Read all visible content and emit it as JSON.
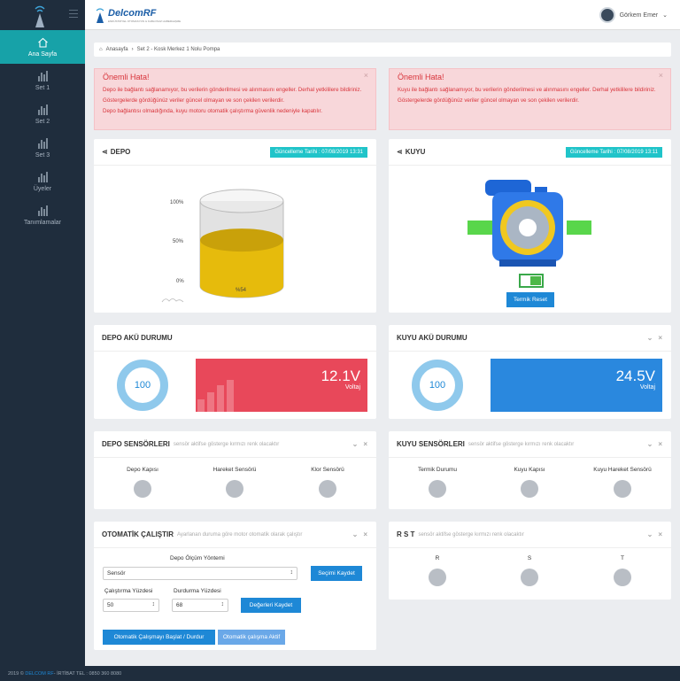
{
  "app": {
    "brand": "DelcomRF",
    "brand_sub": "ENDÜSTRİYEL OTOMASYON & KABLOSUZ HABERLEŞME",
    "user_name": "Görkem Emer"
  },
  "sidebar": {
    "items": [
      {
        "label": "Ana Sayfa",
        "icon": "home-icon",
        "active": true
      },
      {
        "label": "Set 1",
        "icon": "chart-icon"
      },
      {
        "label": "Set 2",
        "icon": "chart-icon"
      },
      {
        "label": "Set 3",
        "icon": "chart-icon"
      },
      {
        "label": "Üyeler",
        "icon": "chart-icon"
      },
      {
        "label": "Tanımlamalar",
        "icon": "chart-icon"
      }
    ]
  },
  "breadcrumb": {
    "home": "Anasayfa",
    "current": "Set 2 - Kosk Merkez 1 Nolu Pompa"
  },
  "alerts": {
    "left": {
      "title": "Önemli Hata!",
      "lines": [
        "Depo ile bağlantı sağlanamıyor, bu verilerin gönderilmesi ve alınmasını engeller. Derhal yetkililere bildiriniz.",
        "Göstergelerde gördüğünüz veriler güncel olmayan ve son çekilen verilerdir.",
        "Depo bağlantısı olmadığında, kuyu motoru otomatik çalıştırma güvenlik nedeniyle kapatılır."
      ]
    },
    "right": {
      "title": "Önemli Hata!",
      "lines": [
        "Kuyu ile bağlantı sağlanamıyor, bu verilerin gönderilmesi ve alınmasını engeller. Derhal yetkililere bildiriniz.",
        "Göstergelerde gördüğünüz veriler güncel olmayan ve son çekilen verilerdir."
      ]
    }
  },
  "depo": {
    "title": "DEPO",
    "date": "Güncelleme Tarihi : 07/08/2019 13:31",
    "scale": [
      "100%",
      "50%",
      "0%"
    ],
    "level_label": "%54",
    "level": 0.54
  },
  "kuyu": {
    "title": "KUYU",
    "date": "Güncelleme Tarihi : 07/08/2019 13:11",
    "reset_label": "Termik Reset"
  },
  "depo_aku": {
    "title": "DEPO AKÜ DURUMU",
    "gauge": "100",
    "value": "12.1V",
    "label": "Voltaj",
    "color": "#e8485a"
  },
  "kuyu_aku": {
    "title": "KUYU AKÜ DURUMU",
    "gauge": "100",
    "value": "24.5V",
    "label": "Voltaj",
    "color": "#2a88de"
  },
  "depo_sensor": {
    "title": "DEPO SENSÖRLERI",
    "sub": "sensör aktifse gösterge kırmızı renk olacaktır",
    "items": [
      "Depo Kapısı",
      "Hareket Sensörü",
      "Klor Sensörü"
    ]
  },
  "kuyu_sensor": {
    "title": "KUYU SENSÖRLERI",
    "sub": "sensör aktifse gösterge kırmızı renk olacaktır",
    "items": [
      "Termik Durumu",
      "Kuyu Kapısı",
      "Kuyu Hareket Sensörü"
    ]
  },
  "oto": {
    "title": "OTOMATİK ÇALIŞTIR",
    "sub": "Ayarlanan duruma göre motor otomatik olarak çalıştır",
    "method_label": "Depo Ölçüm Yöntemi",
    "method_value": "Sensör",
    "save_choice": "Seçimi Kaydet",
    "start_label": "Çalıştırma Yüzdesi",
    "start_value": "50",
    "stop_label": "Durdurma Yüzdesi",
    "stop_value": "68",
    "save_values": "Değerleri Kaydet",
    "toggle": "Otomatik Çalışmayı Başlat / Durdur",
    "active": "Otomatik çalışma Aktif"
  },
  "rst": {
    "title": "R S T",
    "sub": "sensör aktifse gösterge kırmızı renk olacaktır",
    "items": [
      "R",
      "S",
      "T"
    ]
  },
  "footer": {
    "year": "2019 ©",
    "brand": "DELCOM RF",
    "contact": " - İRTİBAT TEL : 0850 360 8080"
  }
}
